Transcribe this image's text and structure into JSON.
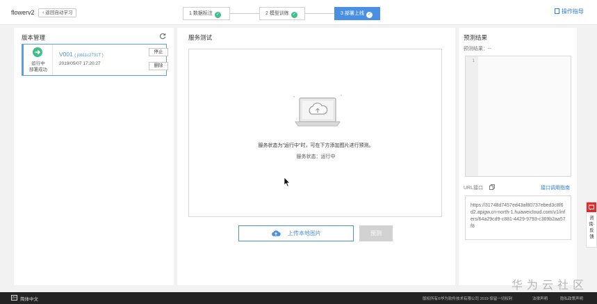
{
  "header": {
    "app_name": "flowerv2",
    "back_label": "返回自动学习",
    "steps": [
      {
        "label": "1 数据标注"
      },
      {
        "label": "2 模型训练"
      },
      {
        "label": "3 部署上线"
      }
    ],
    "guide_label": "操作指导"
  },
  "version_panel": {
    "title": "版本管理",
    "card": {
      "status_line1": "运行中",
      "status_line2": "部署成功",
      "version": "V001",
      "job": "( job11c2731T )",
      "time": "2019/05/07 17:20:27",
      "stop_label": "停止",
      "delete_label": "删除"
    }
  },
  "test_panel": {
    "title": "服务测试",
    "hint": "服务状态为\"运行中\"时，可在下方添加图片进行预测。",
    "status": "服务状态：运行中",
    "upload_label": "上传本地图片",
    "predict_label": "预测"
  },
  "result_panel": {
    "title": "预测结果",
    "result_label": "预测结果：--",
    "line_number": "1",
    "url_label": "URL接口",
    "api_link": "接口调用指南",
    "url": "https://31748d7457ed43af80737ebed3c8f6d2.apigw.cn-north-1.huaweicloud.com/v1/infers/64a29cd9-c881-4429-9793-c369b2aa57f8"
  },
  "feedback": {
    "label": "咨询·反馈"
  },
  "watermark": "华为云社区",
  "footer": {
    "lang_badge": "ZH",
    "lang": "简体中文",
    "copyright": "版权所有©华为软件技术有限公司 2019 保留一切权利",
    "links": [
      "法律声明",
      "隐私政策声明"
    ]
  },
  "colors": {
    "accent": "#4a90e2",
    "success": "#3fbf8a",
    "danger": "#e32b2b"
  }
}
